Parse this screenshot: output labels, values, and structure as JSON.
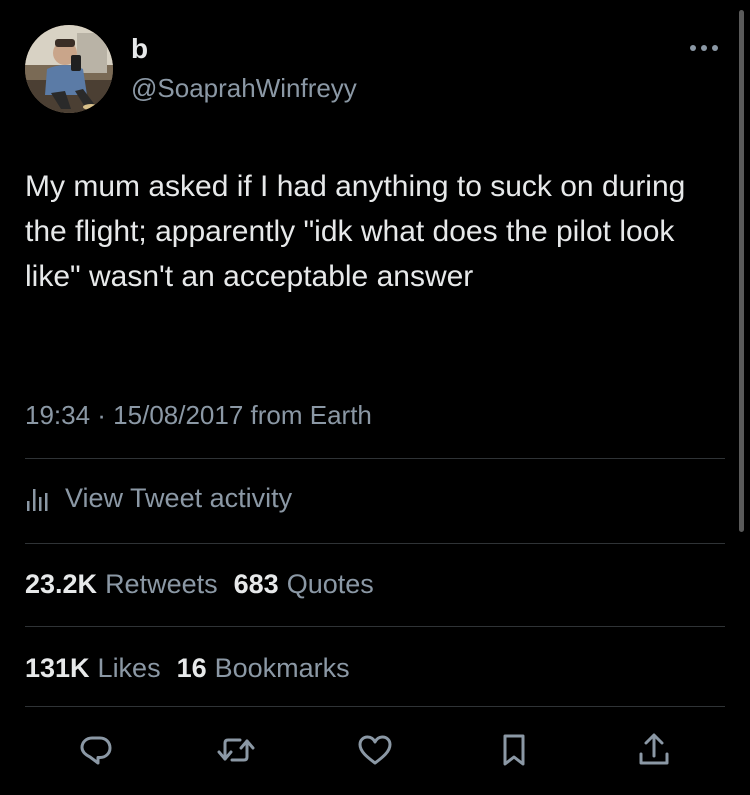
{
  "author": {
    "display_name": "b",
    "handle": "@SoaprahWinfreyy"
  },
  "tweet": {
    "text": "My mum asked if I had anything to suck on during the flight; apparently \"idk what does the pilot look like\" wasn't an acceptable answer",
    "meta": "19:34 · 15/08/2017 from Earth"
  },
  "activity": {
    "label": "View Tweet activity"
  },
  "stats": {
    "retweets_count": "23.2K",
    "retweets_label": "Retweets",
    "quotes_count": "683",
    "quotes_label": "Quotes",
    "likes_count": "131K",
    "likes_label": "Likes",
    "bookmarks_count": "16",
    "bookmarks_label": "Bookmarks"
  },
  "icons": {
    "more": "more-horizontal-icon",
    "analytics": "bar-chart-icon",
    "reply": "reply-icon",
    "retweet": "retweet-icon",
    "like": "heart-icon",
    "bookmark": "bookmark-icon",
    "share": "share-icon"
  },
  "colors": {
    "background": "#000000",
    "primary_text": "#e7e9ea",
    "secondary_text": "#8b98a5",
    "divider": "#2f3336"
  }
}
